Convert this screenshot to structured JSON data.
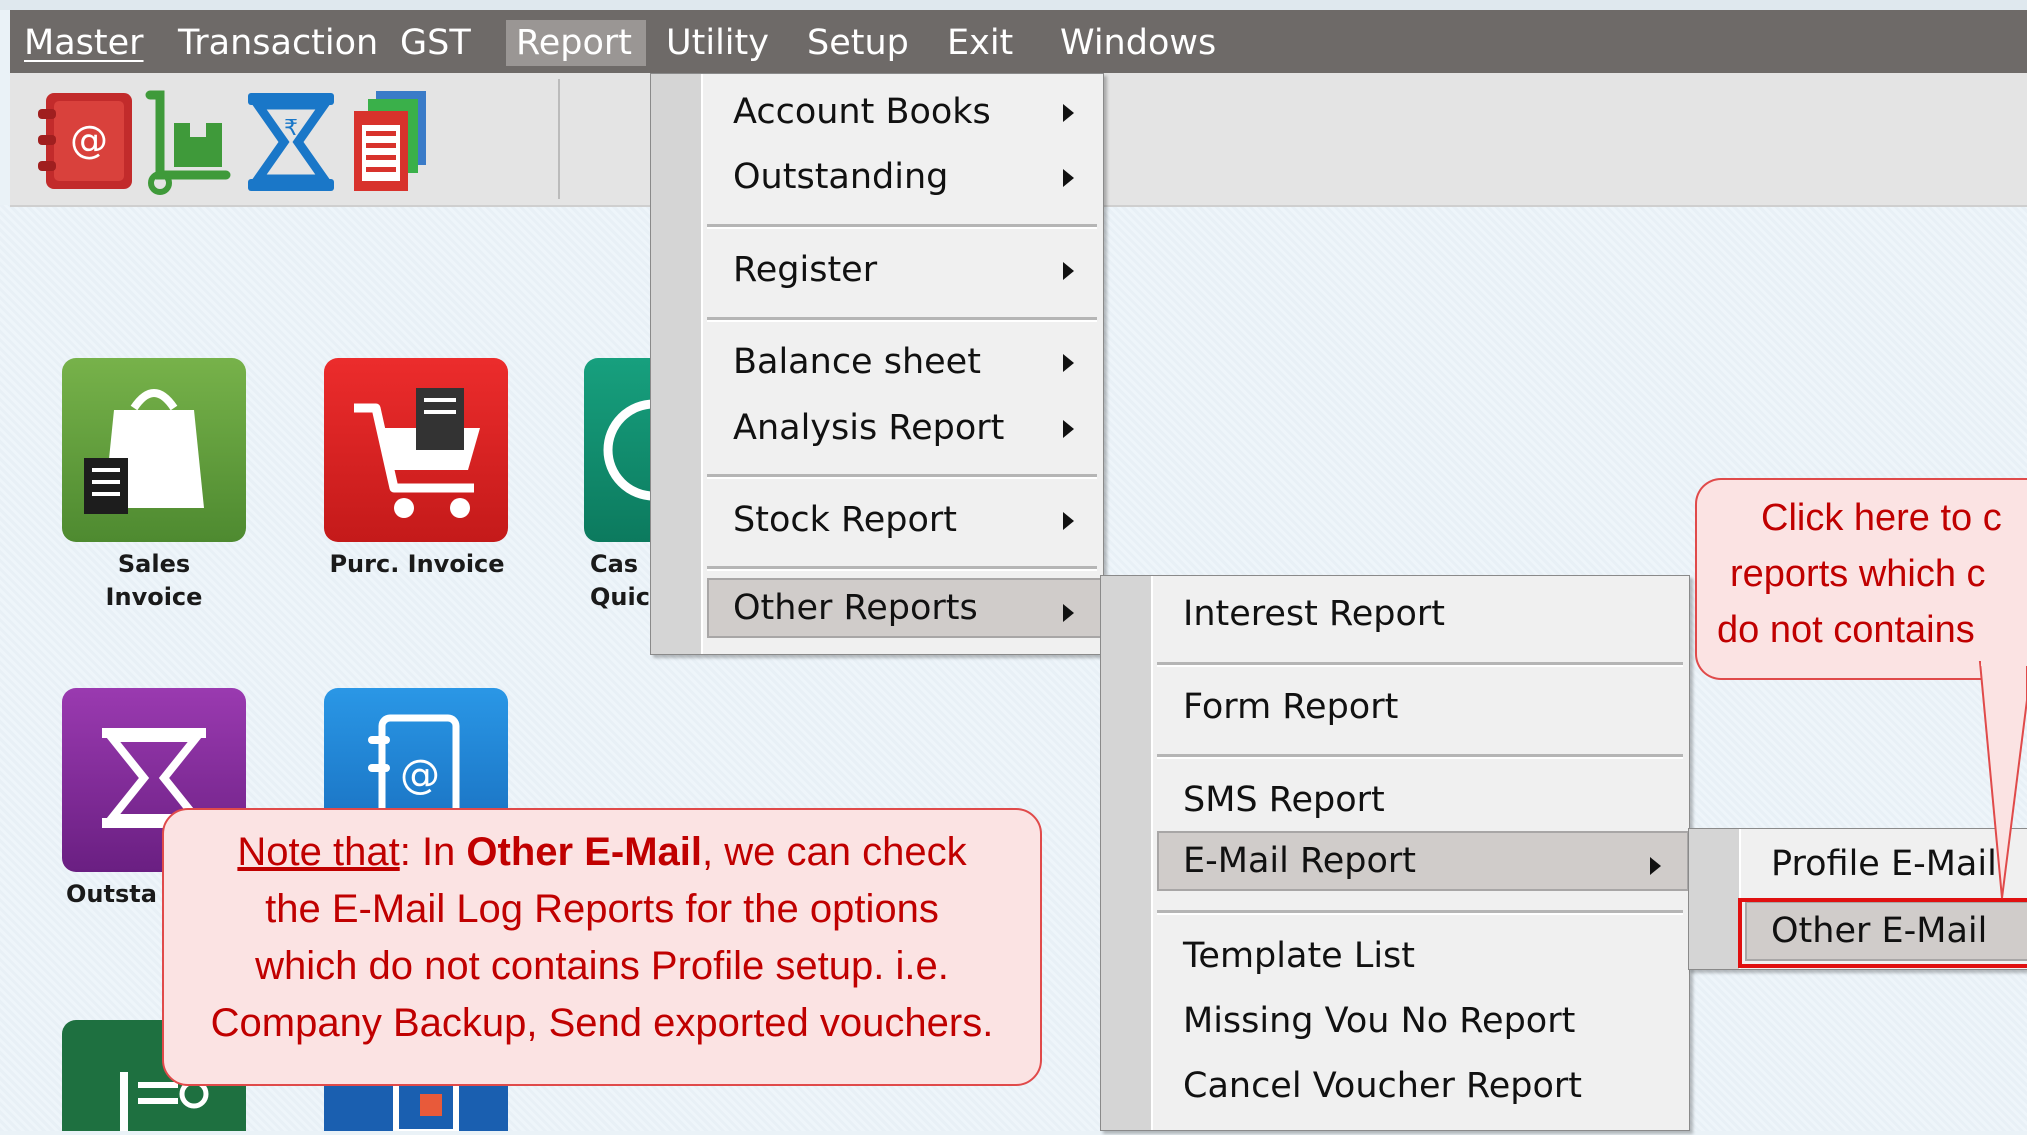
{
  "menubar": {
    "items": [
      {
        "label": "Master",
        "mnemonic": "M"
      },
      {
        "label": "Transaction",
        "mnemonic": "T"
      },
      {
        "label": "GST",
        "mnemonic": "G"
      },
      {
        "label": "Report",
        "mnemonic": "R",
        "active": true
      },
      {
        "label": "Utility",
        "mnemonic": "U"
      },
      {
        "label": "Setup",
        "mnemonic": "S"
      },
      {
        "label": "Exit",
        "mnemonic": "E"
      },
      {
        "label": "Windows",
        "mnemonic": "W"
      }
    ]
  },
  "toolbar": {
    "icons": [
      "address-book-icon",
      "trolley-icon",
      "hourglass-rupee-icon",
      "documents-icon"
    ]
  },
  "tiles": [
    {
      "label_line1": "Sales",
      "label_line2": "Invoice",
      "icon": "shopping-bag-icon",
      "color": "#5e9a3a"
    },
    {
      "label_line1": "Purc. Invoice",
      "label_line2": "",
      "icon": "shopping-cart-icon",
      "color": "#d61e22"
    },
    {
      "label_line1": "Cas",
      "label_line2": "Quic",
      "icon": "cash-icon",
      "color": "#108a6c"
    },
    {
      "label_line1": "Outsta",
      "label_line2": "",
      "icon": "hourglass-icon",
      "color": "#7a2a92"
    },
    {
      "label_line1": "",
      "label_line2": "",
      "icon": "address-book-icon",
      "color": "#1a7fd0"
    },
    {
      "label_line1": "",
      "label_line2": "",
      "icon": "report-icon",
      "color": "#1e7040"
    },
    {
      "label_line1": "",
      "label_line2": "",
      "icon": "report-icon",
      "color": "#1a5fb0"
    }
  ],
  "report_menu": {
    "items": [
      {
        "label": "Account Books",
        "has_submenu": true
      },
      {
        "label": "Outstanding",
        "has_submenu": true
      },
      {
        "label": "Register",
        "has_submenu": true
      },
      {
        "label": "Balance sheet",
        "has_submenu": true
      },
      {
        "label": "Analysis Report",
        "has_submenu": true
      },
      {
        "label": "Stock Report",
        "has_submenu": true
      },
      {
        "label": "Other Reports",
        "has_submenu": true,
        "highlighted": true
      }
    ]
  },
  "other_reports_menu": {
    "items": [
      {
        "label": "Interest Report"
      },
      {
        "label": "Form Report"
      },
      {
        "label": "SMS Report"
      },
      {
        "label": "E-Mail Report",
        "has_submenu": true,
        "highlighted": true
      },
      {
        "label": "Template List"
      },
      {
        "label": "Missing Vou No Report"
      },
      {
        "label": "Cancel Voucher Report"
      }
    ]
  },
  "email_menu": {
    "items": [
      {
        "label": "Profile E-Mail"
      },
      {
        "label": "Other E-Mail",
        "highlighted": true
      }
    ]
  },
  "callout_right": {
    "line1": "Click here to c",
    "line2": "reports which c",
    "line3": "do not contains"
  },
  "callout_note": {
    "prefix_underlined": "Note that",
    "text1": ": In ",
    "bold": "Other E-Mail",
    "text2": ", we can check",
    "line2": "the E-Mail Log Reports for the options",
    "line3": "which do not contains Profile setup. i.e.",
    "line4": "Company Backup, Send exported vouchers."
  },
  "colors": {
    "menubar": "#6e6a68",
    "callout_text": "#c00000",
    "callout_bg": "#fbe3e3",
    "highlight_border": "#e01010"
  }
}
